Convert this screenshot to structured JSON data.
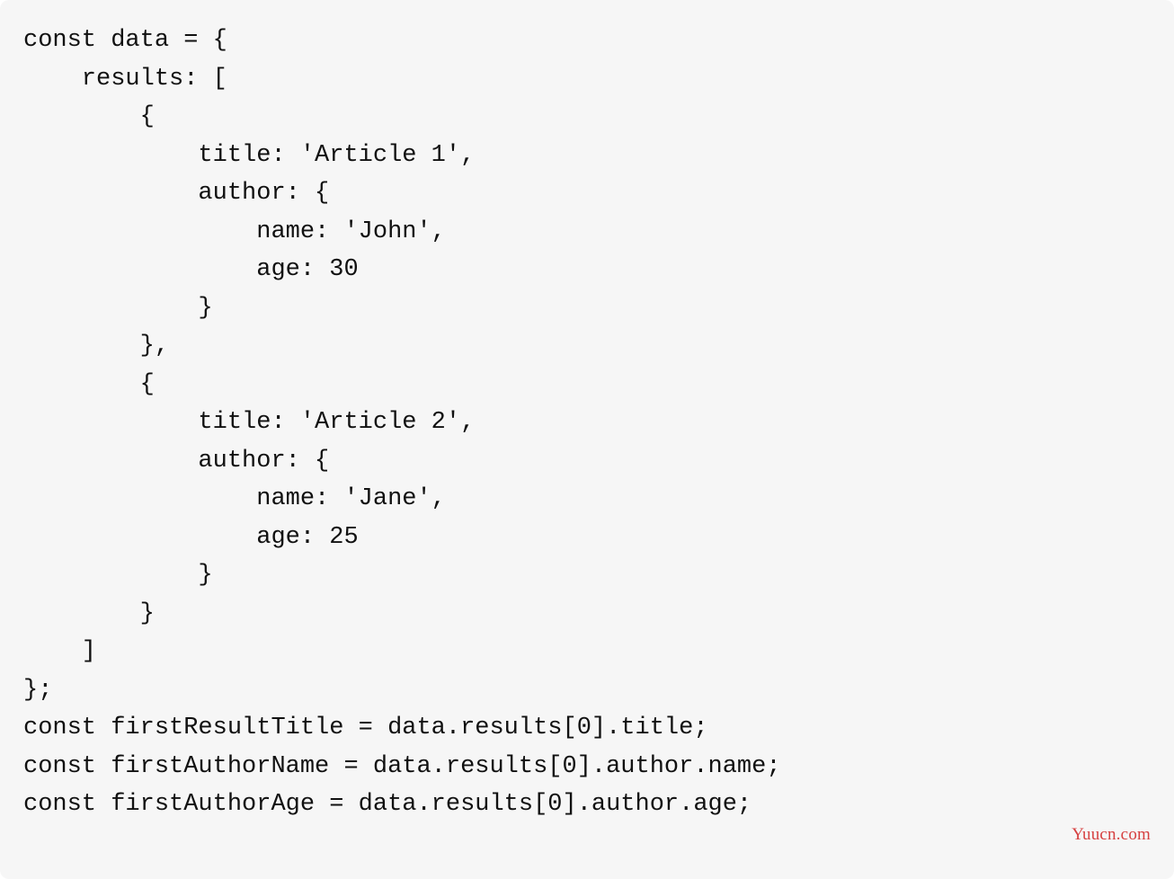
{
  "code": {
    "lines": [
      "const data = {",
      "    results: [",
      "        {",
      "            title: 'Article 1',",
      "            author: {",
      "                name: 'John',",
      "                age: 30",
      "            }",
      "        },",
      "        {",
      "            title: 'Article 2',",
      "            author: {",
      "                name: 'Jane',",
      "                age: 25",
      "            }",
      "        }",
      "    ]",
      "};",
      "const firstResultTitle = data.results[0].title;",
      "const firstAuthorName = data.results[0].author.name;",
      "const firstAuthorAge = data.results[0].author.age;"
    ]
  },
  "watermark": "Yuucn.com"
}
